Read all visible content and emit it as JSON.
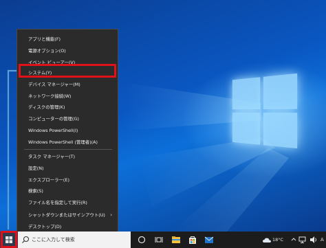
{
  "menu": {
    "items": [
      {
        "label": "アプリと機能(F)"
      },
      {
        "label": "電源オプション(O)"
      },
      {
        "label": "イベント ビューアー(V)"
      },
      {
        "label": "システム(Y)"
      },
      {
        "label": "デバイス マネージャー(M)"
      },
      {
        "label": "ネットワーク接続(W)"
      },
      {
        "label": "ディスクの管理(K)"
      },
      {
        "label": "コンピューターの管理(G)"
      },
      {
        "label": "Windows PowerShell(I)"
      },
      {
        "label": "Windows PowerShell (管理者)(A)"
      },
      {
        "label": "タスク マネージャー(T)"
      },
      {
        "label": "設定(N)"
      },
      {
        "label": "エクスプローラー(E)"
      },
      {
        "label": "検索(S)"
      },
      {
        "label": "ファイル名を指定して実行(R)"
      },
      {
        "label": "シャットダウンまたはサインアウト(U)",
        "submenu_arrow": "›"
      },
      {
        "label": "デスクトップ(D)"
      }
    ],
    "highlighted_item": "システム(Y)"
  },
  "taskbar": {
    "search_placeholder": "ここに入力して検索",
    "temperature": "18°C",
    "ime_indicator": "A",
    "icons": [
      "windows-start-icon",
      "search-icon",
      "task-view-icon",
      "widgets-icon",
      "file-explorer-icon",
      "store-icon",
      "mail-icon",
      "weather-icon",
      "chevron-up-icon",
      "network-icon",
      "volume-icon"
    ]
  },
  "colors": {
    "highlight_border": "#e0111b",
    "menu_bg": "#2b2b2b",
    "taskbar_bg": "#1c1c1c",
    "accent_arrow": "#5aa0d8"
  }
}
